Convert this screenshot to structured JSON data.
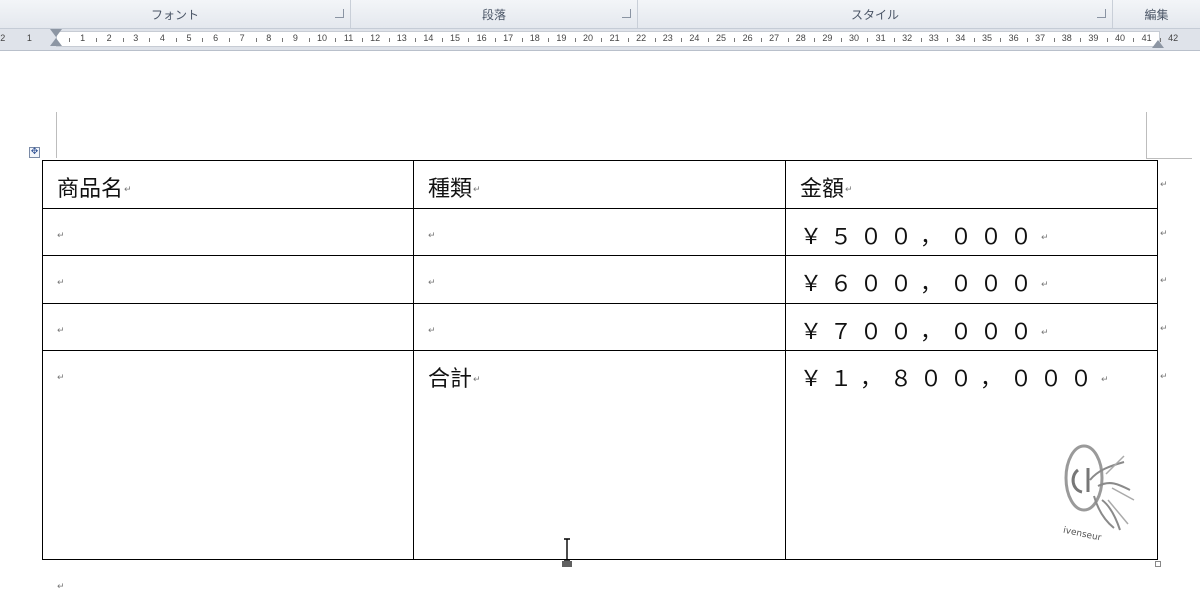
{
  "ribbon": {
    "groups": [
      {
        "label": "フォント"
      },
      {
        "label": "段落"
      },
      {
        "label": "スタイル"
      },
      {
        "label": "編集"
      }
    ]
  },
  "ruler": {
    "left_numbers": [
      "2",
      "1"
    ],
    "numbers": [
      "1",
      "2",
      "3",
      "4",
      "5",
      "6",
      "7",
      "8",
      "9",
      "10",
      "11",
      "12",
      "13",
      "14",
      "15",
      "16",
      "17",
      "18",
      "19",
      "20",
      "21",
      "22",
      "23",
      "24",
      "25",
      "26",
      "27",
      "28",
      "29",
      "30",
      "31",
      "32",
      "33",
      "34",
      "35",
      "36",
      "37",
      "38",
      "39",
      "40",
      "41",
      "42"
    ]
  },
  "table": {
    "headers": [
      "商品名",
      "種類",
      "金額"
    ],
    "rows": [
      {
        "name": "",
        "kind": "",
        "amount": "￥５００，０００"
      },
      {
        "name": "",
        "kind": "",
        "amount": "￥６００，０００"
      },
      {
        "name": "",
        "kind": "",
        "amount": "￥７００，０００"
      }
    ],
    "total": {
      "label": "合計",
      "amount": "￥１，８００，０００"
    }
  },
  "marks": {
    "paragraph": "↵"
  },
  "watermark": {
    "text": "ivenseur"
  }
}
